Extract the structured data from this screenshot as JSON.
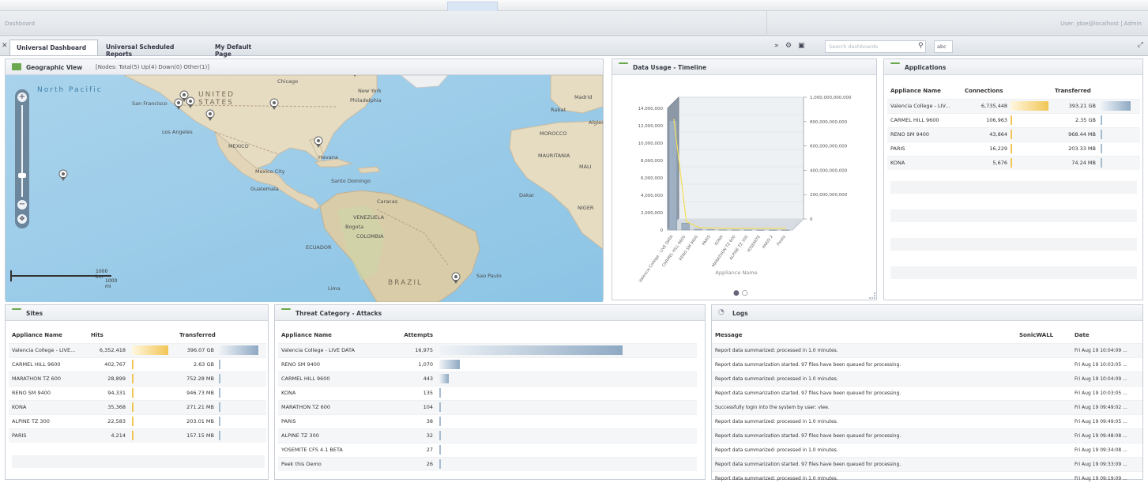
{
  "topbar": {
    "crumb": "Dashboard",
    "user": "User: jdoe@localhost | Admin"
  },
  "tabs": [
    {
      "label": "Universal Dashboard"
    },
    {
      "label": "Universal Scheduled Reports"
    },
    {
      "label": "My Default Page"
    }
  ],
  "toolbar": {
    "search_placeholder": "Search dashboards",
    "search_qualifier": "abc"
  },
  "geo_panel": {
    "title": "Geographic View",
    "note": "[Nodes: Total(5) Up(4) Down(0) Other(1)]",
    "labels": {
      "north_pacific": "North Pacific",
      "united_states": "UNITED STATES",
      "mexico": "MEXICO",
      "mexico_city": "Mexico City",
      "brazil": "BRAZIL",
      "colombia": "COLOMBIA",
      "ecuador": "ECUADOR",
      "venezuela": "VENEZUELA",
      "bogota": "Bogota",
      "lima": "Lima",
      "los_angeles": "Los Angeles",
      "san_francisco": "San Francisco",
      "chicago": "Chicago",
      "new_york": "New York",
      "philadelphia": "Philadelphia",
      "havana": "Havana",
      "caracas": "Caracas",
      "morocco": "MOROCCO",
      "mali": "MALI",
      "niger": "NIGER",
      "mauritania": "MAURITANIA",
      "dakar": "Dakar",
      "guatemala": "Guatemala",
      "santo_domingo": "Santo Domingo",
      "sao_paulo": "Sao Paulo",
      "madrid": "Madrid",
      "algiers": "Algiers",
      "morocco_rabat": "Rabat"
    },
    "scale_km": "1000 km",
    "scale_mi": "1000 mi"
  },
  "data_usage_panel": {
    "title": "Data Usage - Timeline",
    "xlabel": "Appliance Name",
    "pager": "● ○"
  },
  "chart_data": {
    "type": "bar",
    "title": "Data Usage - Timeline",
    "xlabel": "Appliance Name",
    "categories": [
      "Valencia College - LIVE DATA",
      "CARMEL HILL 9600",
      "RENO SM 9400",
      "PARIS",
      "KONA",
      "MARATHON TZ 600",
      "ALPINE TZ 300",
      "YOSEMITE",
      "PARIS 2",
      "Fiesta"
    ],
    "series": [
      {
        "values": [
          12600000,
          800000,
          100000,
          50000,
          20000,
          10000,
          8000,
          5000,
          3000,
          1000
        ]
      }
    ],
    "left_ticks": [
      "0",
      "2,000,000",
      "4,000,000",
      "6,000,000",
      "8,000,000",
      "10,000,000",
      "12,000,000",
      "14,000,000"
    ],
    "right_ticks": [
      "0",
      "200,000,000,000",
      "400,000,000,000",
      "600,000,000,000",
      "800,000,000,000",
      "1,000,000,000,000"
    ],
    "ylim": [
      0,
      14000000
    ]
  },
  "applications_panel": {
    "title": "Applications",
    "columns": [
      "Appliance Name",
      "Connections",
      "Transferred"
    ],
    "rows": [
      {
        "name": "Valencia College - LIV...",
        "connections": "6,735,448",
        "transferred": "393.21 GB",
        "conn_frac": 1.0,
        "xfer_frac": 1.0
      },
      {
        "name": "CARMEL HILL 9600",
        "connections": "106,963",
        "transferred": "2.35 GB",
        "conn_frac": 0.02,
        "xfer_frac": 0.01
      },
      {
        "name": "RENO SM 9400",
        "connections": "43,864",
        "transferred": "968.44 MB",
        "conn_frac": 0.01,
        "xfer_frac": 0.01
      },
      {
        "name": "PARIS",
        "connections": "16,229",
        "transferred": "203.33 MB",
        "conn_frac": 0.01,
        "xfer_frac": 0.01
      },
      {
        "name": "KONA",
        "connections": "5,676",
        "transferred": "74.24 MB",
        "conn_frac": 0.01,
        "xfer_frac": 0.01
      }
    ]
  },
  "sites_panel": {
    "title": "Sites",
    "columns": [
      "Appliance Name",
      "Hits",
      "Transferred"
    ],
    "rows": [
      {
        "name": "Valencia College - LIVE...",
        "hits": "6,352,418",
        "transferred": "396.07 GB",
        "hits_frac": 1.0,
        "xfer_frac": 1.0
      },
      {
        "name": "CARMEL HILL 9600",
        "hits": "402,767",
        "transferred": "2.63 GB",
        "hits_frac": 0.02,
        "xfer_frac": 0.01
      },
      {
        "name": "MARATHON TZ 600",
        "hits": "28,899",
        "transferred": "752.28 MB",
        "hits_frac": 0.01,
        "xfer_frac": 0.01
      },
      {
        "name": "RENO SM 9400",
        "hits": "94,331",
        "transferred": "946.73 MB",
        "hits_frac": 0.01,
        "xfer_frac": 0.01
      },
      {
        "name": "KONA",
        "hits": "35,368",
        "transferred": "271.21 MB",
        "hits_frac": 0.01,
        "xfer_frac": 0.01
      },
      {
        "name": "ALPINE TZ 300",
        "hits": "22,583",
        "transferred": "203.01 MB",
        "hits_frac": 0.01,
        "xfer_frac": 0.01
      },
      {
        "name": "PARIS",
        "hits": "4,214",
        "transferred": "157.15 MB",
        "hits_frac": 0.01,
        "xfer_frac": 0.01
      }
    ]
  },
  "threat_panel": {
    "title": "Threat Category - Attacks",
    "columns": [
      "Appliance Name",
      "Attempts"
    ],
    "rows": [
      {
        "name": "Valencia College - LIVE DATA",
        "attempts": "16,975",
        "frac": 1.0
      },
      {
        "name": "RENO SM 9400",
        "attempts": "1,070",
        "frac": 0.11
      },
      {
        "name": "CARMEL HILL 9600",
        "attempts": "443",
        "frac": 0.05
      },
      {
        "name": "KONA",
        "attempts": "135",
        "frac": 0.01
      },
      {
        "name": "MARATHON TZ 600",
        "attempts": "104",
        "frac": 0.01
      },
      {
        "name": "PARIS",
        "attempts": "38",
        "frac": 0.01
      },
      {
        "name": "ALPINE TZ 300",
        "attempts": "32",
        "frac": 0.01
      },
      {
        "name": "YOSEMITE CFS 4.1 BETA",
        "attempts": "27",
        "frac": 0.01
      },
      {
        "name": "Peek this Demo",
        "attempts": "26",
        "frac": 0.01
      }
    ]
  },
  "logs_panel": {
    "title": "Logs",
    "columns": [
      "Message",
      "SonicWALL",
      "Date"
    ],
    "rows": [
      {
        "message": "Report data summarized: processed in 1.0 minutes.",
        "device": "",
        "date": "Fri Aug 19 10:04:09 ..."
      },
      {
        "message": "Report data summarization started. 97 files have been queued for processing.",
        "device": "",
        "date": "Fri Aug 19 10:03:05 ..."
      },
      {
        "message": "Report data summarized: processed in 1.0 minutes.",
        "device": "",
        "date": "Fri Aug 19 10:04:09 ..."
      },
      {
        "message": "Report data summarization started. 97 files have been queued for processing.",
        "device": "",
        "date": "Fri Aug 19 10:03:05 ..."
      },
      {
        "message": "Successfully login into the system by user: vlee.",
        "device": "",
        "date": "Fri Aug 19 09:49:02 ..."
      },
      {
        "message": "Report data summarized: processed in 1.0 minutes.",
        "device": "",
        "date": "Fri Aug 19 09:49:05 ..."
      },
      {
        "message": "Report data summarization started. 97 files have been queued for processing.",
        "device": "",
        "date": "Fri Aug 19 09:48:08 ..."
      },
      {
        "message": "Report data summarized: processed in 1.0 minutes.",
        "device": "",
        "date": "Fri Aug 19 09:34:08 ..."
      },
      {
        "message": "Report data summarization started. 97 files have been queued for processing.",
        "device": "",
        "date": "Fri Aug 19 09:33:09 ..."
      },
      {
        "message": "Report data summarized: processed in 1.0 minutes.",
        "device": "",
        "date": "Fri Aug 19 09:19:09 ..."
      }
    ]
  }
}
